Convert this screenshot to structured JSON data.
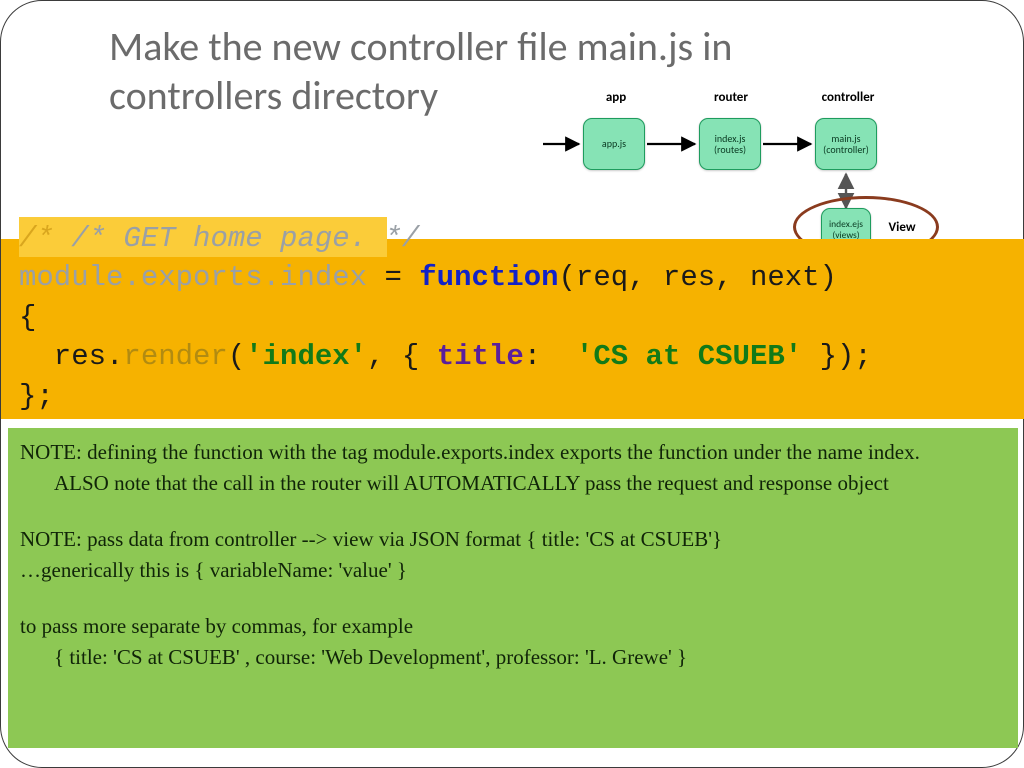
{
  "title": "Make the new controller file main.js in controllers directory",
  "diagram": {
    "labels": {
      "app": "app",
      "router": "router",
      "controller": "controller",
      "view": "View"
    },
    "boxes": {
      "app": "app.js",
      "router": "index.js\n(routes)",
      "ctrl": "main.js\n(controller)",
      "views": "index.ejs\n(views)"
    }
  },
  "code": {
    "c0a": "/* ",
    "c0b": "/* GET home page. */",
    "l1a": "module.exports.index",
    "l1b": " = ",
    "l1c": "function",
    "l1d": "(req, res, next)",
    "l2": "{",
    "l3a": "  res.",
    "l3b": "render",
    "l3c": "(",
    "l3d": "'index'",
    "l3e": ", { ",
    "l3f": "title",
    "l3g": ": ",
    "l3h": " 'CS at CSUEB'",
    "l3i": " });",
    "l4": "};"
  },
  "notes": {
    "n1": "NOTE: defining the function with the tag module.exports.index exports the function under the name index.",
    "n1b": "ALSO note that the call in the router will AUTOMATICALLY pass the request and response object",
    "n2": "NOTE: pass data from controller --> view via JSON format { title: 'CS at CSUEB'}",
    "n2b": "…generically this is { variableName: 'value' }",
    "n3": " to pass more separate by commas, for example",
    "n3b": "{ title: 'CS at CSUEB' , course: 'Web Development', professor: 'L. Grewe' }"
  }
}
